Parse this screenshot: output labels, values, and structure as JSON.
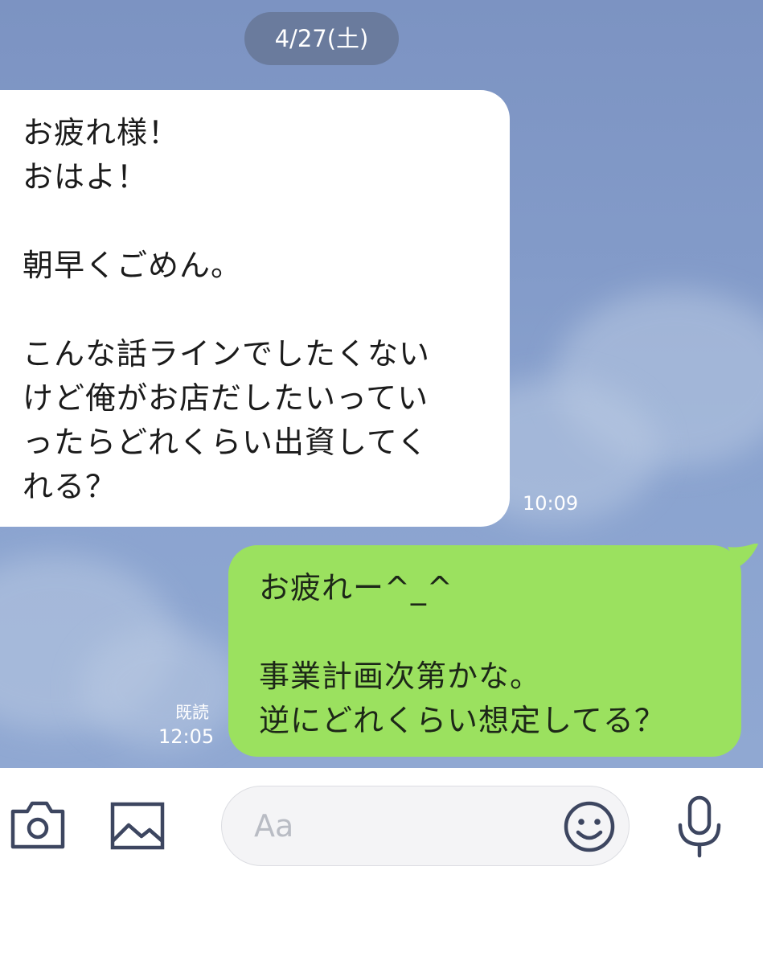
{
  "chat": {
    "date": "4/27(土)",
    "messages": [
      {
        "direction": "incoming",
        "text": "お疲れ様！\nおはよ！\n\n朝早くごめん。\n\nこんな話ラインでしたくない\nけど俺がお店だしたいってい\nったらどれくらい出資してく\nれる？",
        "time": "10:09"
      },
      {
        "direction": "outgoing",
        "text": "お疲れー^_^\n\n事業計画次第かな。\n逆にどれくらい想定してる？",
        "read_label": "既読",
        "time": "12:05"
      }
    ]
  },
  "toolbar": {
    "camera_icon": "camera-icon",
    "image_icon": "image-icon",
    "input_placeholder": "Aa",
    "emoji_icon": "smiley-icon",
    "mic_icon": "microphone-icon"
  },
  "colors": {
    "incoming_bubble": "#ffffff",
    "outgoing_bubble": "#9be15f",
    "background": "#8aa3cf",
    "icon": "#3d4660"
  }
}
